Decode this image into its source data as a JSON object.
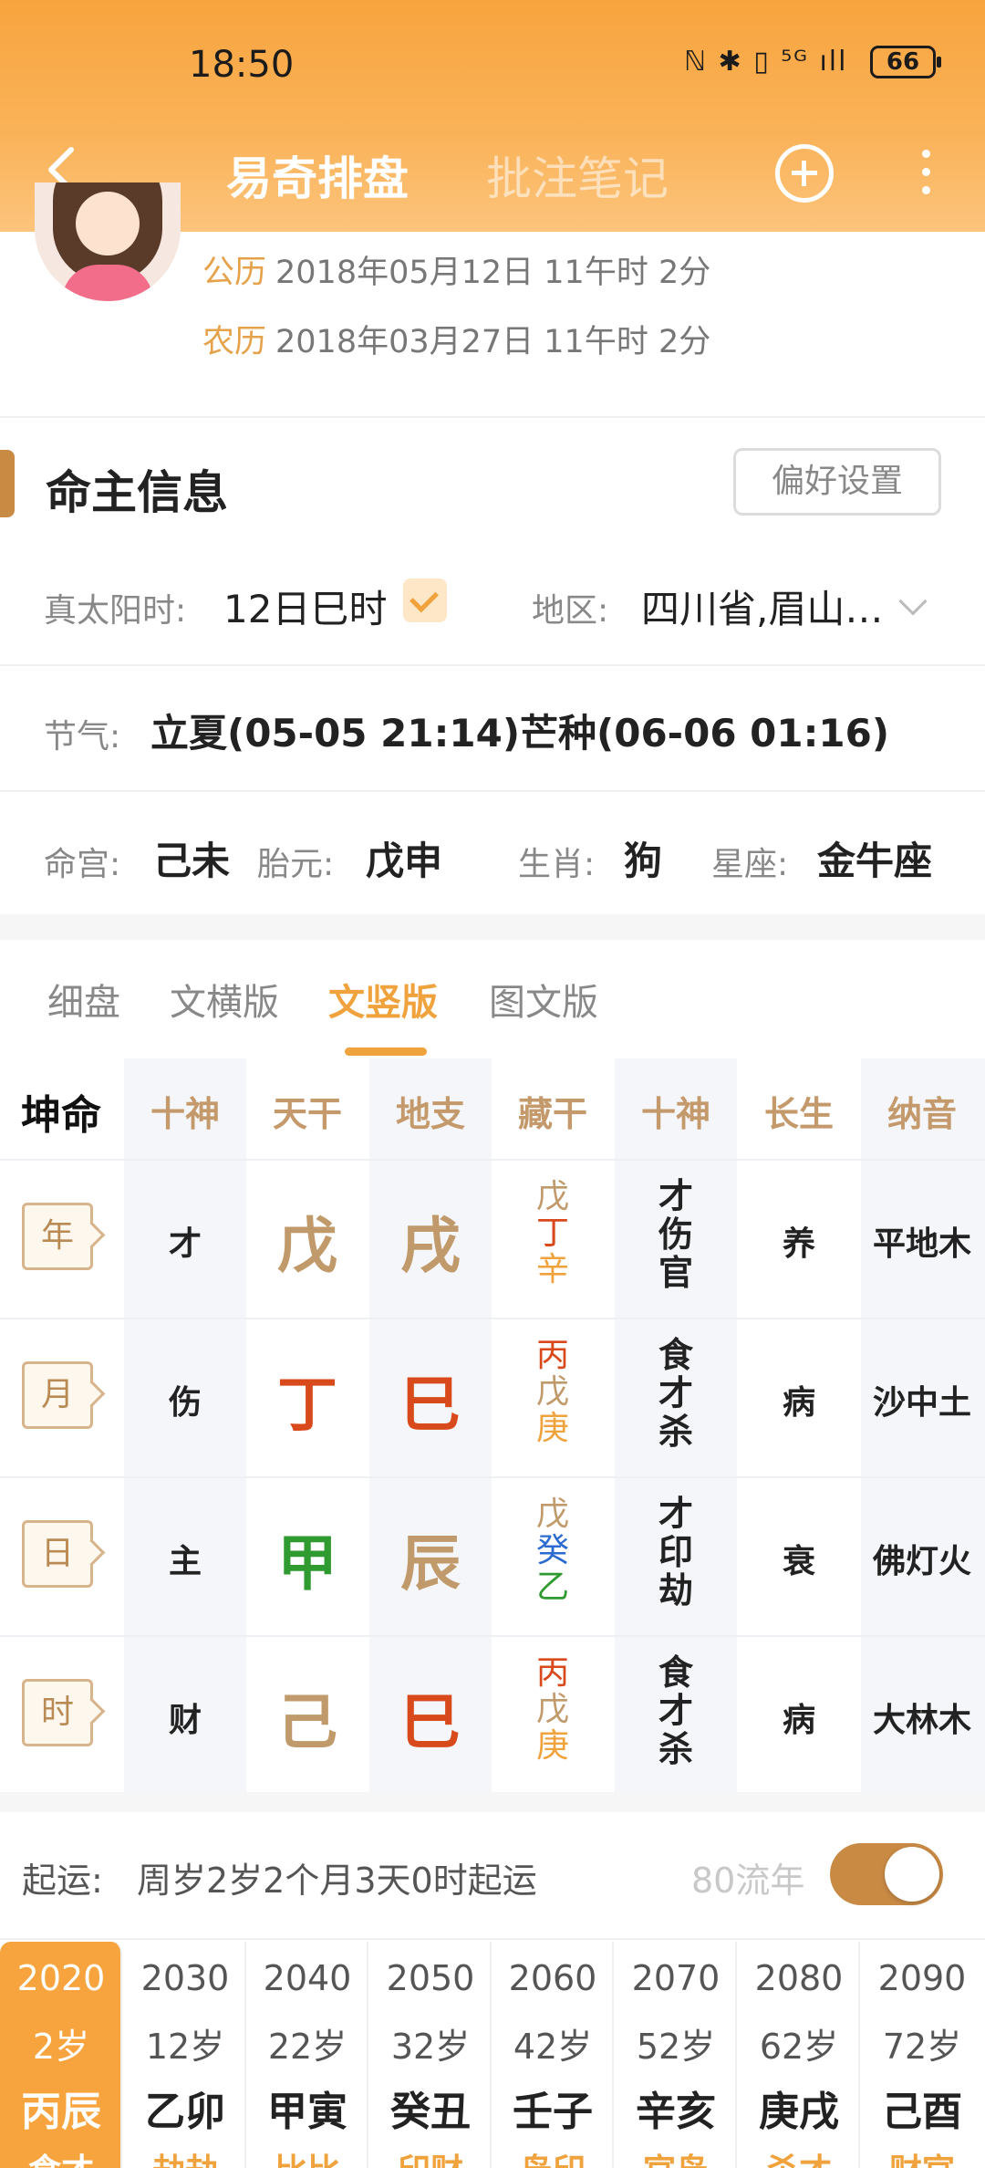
{
  "status": {
    "time": "18:50",
    "icons": "ℕ ✱ ▯ ⁵ᴳ ıll",
    "battery": "66"
  },
  "nav": {
    "title": "易奇排盘",
    "tab2": "批注笔记"
  },
  "profile": {
    "solar_label": "公历",
    "solar_value": "2018年05月12日 11午时 2分",
    "lunar_label": "农历",
    "lunar_value": "2018年03月27日 11午时 2分"
  },
  "info": {
    "section_title": "命主信息",
    "pref_button": "偏好设置",
    "true_solar_label": "真太阳时:",
    "true_solar_value": "12日巳时",
    "region_label": "地区:",
    "region_value": "四川省,眉山…",
    "solar_term_label": "节气:",
    "solar_term_value": "立夏(05-05 21:14)芒种(06-06 01:16)",
    "minggong_label": "命宫:",
    "minggong_value": "己未",
    "taiyuan_label": "胎元:",
    "taiyuan_value": "戊申",
    "zodiac_label": "生肖:",
    "zodiac_value": "狗",
    "star_label": "星座:",
    "star_value": "金牛座"
  },
  "tabs": [
    "细盘",
    "文横版",
    "文竖版",
    "图文版"
  ],
  "grid": {
    "corner": "坤命",
    "headers": [
      "十神",
      "天干",
      "地支",
      "藏干",
      "十神",
      "长生",
      "纳音"
    ],
    "rows": [
      {
        "pillar": "年",
        "shishen": "才",
        "gan": "戊",
        "zhi": "戌",
        "canggan": [
          "戊",
          "丁",
          "辛"
        ],
        "shishen2": [
          "才",
          "伤",
          "官"
        ],
        "changsheng": "养",
        "nayin": "平地木"
      },
      {
        "pillar": "月",
        "shishen": "伤",
        "gan": "丁",
        "zhi": "巳",
        "canggan": [
          "丙",
          "戊",
          "庚"
        ],
        "shishen2": [
          "食",
          "才",
          "杀"
        ],
        "changsheng": "病",
        "nayin": "沙中土"
      },
      {
        "pillar": "日",
        "shishen": "主",
        "gan": "甲",
        "zhi": "辰",
        "canggan": [
          "戊",
          "癸",
          "乙"
        ],
        "shishen2": [
          "才",
          "印",
          "劫"
        ],
        "changsheng": "衰",
        "nayin": "佛灯火"
      },
      {
        "pillar": "时",
        "shishen": "财",
        "gan": "己",
        "zhi": "巳",
        "canggan": [
          "丙",
          "戊",
          "庚"
        ],
        "shishen2": [
          "食",
          "才",
          "杀"
        ],
        "changsheng": "病",
        "nayin": "大林木"
      }
    ]
  },
  "colors": {
    "earth": "#c19a6b",
    "fire": "#d84a1b",
    "metal": "#f0a23d",
    "water": "#2c6bd0",
    "wood": "#2f9a2f",
    "accent": "#f0a23d"
  },
  "luck": {
    "label": "起运:",
    "text": "周岁2岁2个月3天0时起运",
    "flow_label": "80流年",
    "toggle_on": true
  },
  "dayun": [
    {
      "year": "2020",
      "age": "2岁",
      "ganzhi": "丙辰",
      "extra": "食才"
    },
    {
      "year": "2030",
      "age": "12岁",
      "ganzhi": "乙卯",
      "extra": "劫劫"
    },
    {
      "year": "2040",
      "age": "22岁",
      "ganzhi": "甲寅",
      "extra": "比比"
    },
    {
      "year": "2050",
      "age": "32岁",
      "ganzhi": "癸丑",
      "extra": "印财"
    },
    {
      "year": "2060",
      "age": "42岁",
      "ganzhi": "壬子",
      "extra": "枭印"
    },
    {
      "year": "2070",
      "age": "52岁",
      "ganzhi": "辛亥",
      "extra": "官枭"
    },
    {
      "year": "2080",
      "age": "62岁",
      "ganzhi": "庚戌",
      "extra": "杀才"
    },
    {
      "year": "2090",
      "age": "72岁",
      "ganzhi": "己酉",
      "extra": "财官"
    }
  ]
}
